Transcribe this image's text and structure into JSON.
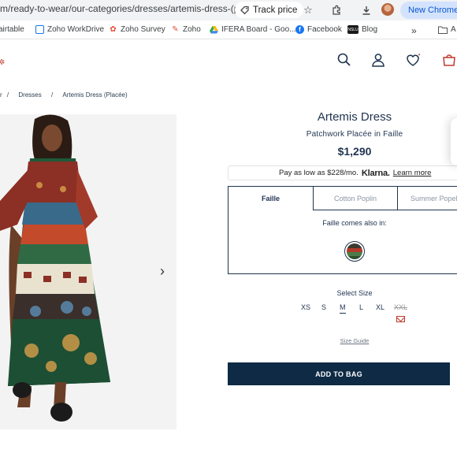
{
  "browser": {
    "url": "m/ready-to-wear/our-categories/dresses/artemis-dress-(pla...",
    "track_price_label": "Track price",
    "new_chrome_label": "New Chrome a"
  },
  "bookmarks": [
    {
      "label": "airtable",
      "icon": "airtable-icon",
      "color": "#fcb400"
    },
    {
      "label": "Zoho WorkDrive",
      "icon": "workdrive-icon",
      "color": "#1a73e8"
    },
    {
      "label": "Zoho Survey",
      "icon": "zoho-survey-icon",
      "color": "#e44d3a"
    },
    {
      "label": "Zoho",
      "icon": "zoho-icon",
      "color": "#e44d3a"
    },
    {
      "label": "IFERA Board - Goo...",
      "icon": "google-drive-icon",
      "color": "#34a853"
    },
    {
      "label": "Facebook",
      "icon": "facebook-icon",
      "color": "#1877f2"
    },
    {
      "label": "Blog",
      "icon": "nslu-icon",
      "color": "#1a1a1a"
    },
    {
      "label": "A",
      "icon": "folder-icon",
      "color": "#555555"
    }
  ],
  "bookmark_nslu_text": "NSLU",
  "breadcrumb": [
    "r",
    "Dresses",
    "Artemis Dress (Placée)"
  ],
  "product": {
    "title": "Artemis Dress",
    "subtitle": "Patchwork Placée in Faille",
    "price": "$1,290",
    "klarna_prefix": "Pay as low as $228/mo.",
    "klarna_brand": "Klarna.",
    "klarna_link": "Learn more",
    "tabs": [
      "Faille",
      "Cotton Poplin",
      "Summer Popel"
    ],
    "active_tab": "Faille",
    "also_in": "Faille comes also in:",
    "select_size": "Select Size",
    "sizes": [
      "XS",
      "S",
      "M",
      "L",
      "XL",
      "XXL"
    ],
    "selected_size": "M",
    "out_of_stock": "XXL",
    "size_guide": "Size Guide",
    "add_to_bag": "ADD TO BAG"
  },
  "colors": {
    "navy": "#0e2a45",
    "text": "#1f3350",
    "accent_red": "#c0392b"
  }
}
